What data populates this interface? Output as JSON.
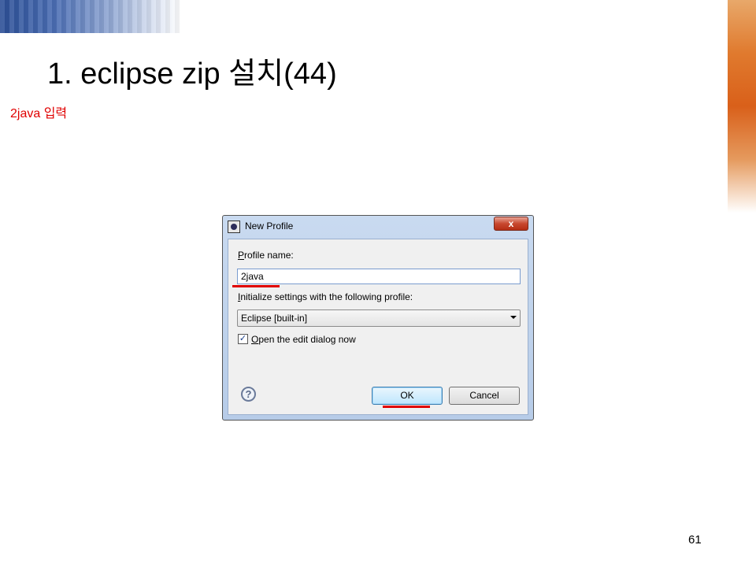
{
  "slide": {
    "title": "1. eclipse zip 설치(44)",
    "caption": "2java 입력",
    "page_number": "61"
  },
  "dialog": {
    "title": "New Profile",
    "close_label": "x",
    "profile_name_access_key": "P",
    "profile_name_label_rest": "rofile name:",
    "profile_name_value": "2java",
    "init_access_key": "I",
    "init_label_rest": "nitialize settings with the following profile:",
    "profile_select_value": "Eclipse [built-in]",
    "open_edit_access_key": "O",
    "open_edit_label_rest": "pen the edit dialog now",
    "open_edit_checked": true,
    "help_icon_glyph": "?",
    "ok_label": "OK",
    "cancel_label": "Cancel",
    "icons": [
      "eclipse-icon",
      "close-icon",
      "chevron-down-icon",
      "checkmark-icon",
      "help-icon"
    ],
    "colors": {
      "annotation_red": "#e00000",
      "titlebar_blue": "#c9daf0",
      "close_red": "#c8482f"
    }
  }
}
